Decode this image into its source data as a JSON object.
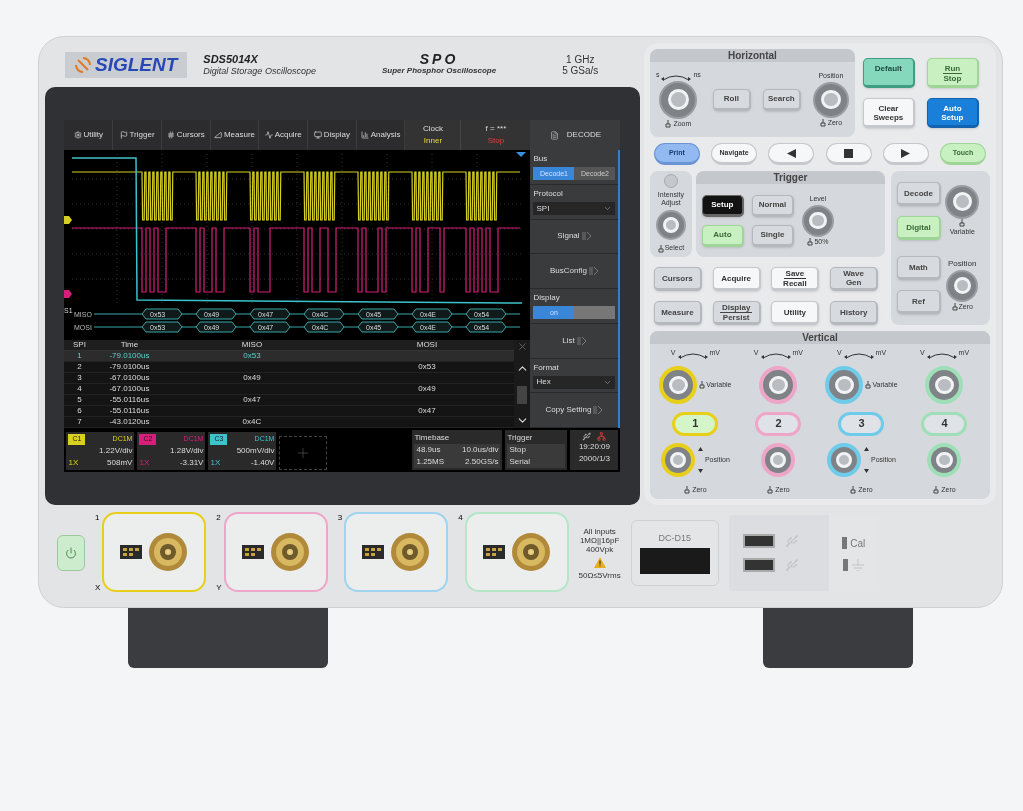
{
  "brand": {
    "logo": "SIGLENT",
    "model": "SDS5014X",
    "description": "Digital Storage Oscilloscope",
    "series": "SPO",
    "series_description": "Super Phosphor Oscilloscope",
    "bandwidth": "1 GHz",
    "sample_rate": "5 GSa/s"
  },
  "screen": {
    "menu": [
      {
        "label": "Utility"
      },
      {
        "label": "Trigger"
      },
      {
        "label": "Cursors"
      },
      {
        "label": "Measure"
      },
      {
        "label": "Acquire"
      },
      {
        "label": "Display"
      },
      {
        "label": "Analysis"
      }
    ],
    "clock": {
      "label": "Clock",
      "value": "Inner"
    },
    "counter": {
      "label": "f = ***",
      "value": "Stop"
    },
    "bus": {
      "label": "S1",
      "lines": [
        {
          "name": "MISO",
          "values": [
            "0x53",
            "0x49",
            "0x47",
            "0x4C",
            "0x45",
            "0x4E",
            "0x54"
          ]
        },
        {
          "name": "MOSI",
          "values": [
            "0x53",
            "0x49",
            "0x47",
            "0x4C",
            "0x45",
            "0x4E",
            "0x54"
          ]
        }
      ]
    },
    "decode_table": {
      "columns": [
        "SPI",
        "Time",
        "MISO",
        "MOSI"
      ],
      "rows": [
        {
          "index": "1",
          "time": "-79.0100us",
          "miso": "0x53",
          "selected": true
        },
        {
          "index": "2",
          "time": "-79.0100us",
          "mosi": "0x53",
          "selected": false
        },
        {
          "index": "3",
          "time": "-67.0100us",
          "miso": "0x49",
          "selected": false
        },
        {
          "index": "4",
          "time": "-67.0100us",
          "mosi": "0x49",
          "selected": false
        },
        {
          "index": "5",
          "time": "-55.0116us",
          "miso": "0x47",
          "selected": false
        },
        {
          "index": "6",
          "time": "-55.0116us",
          "mosi": "0x47",
          "selected": false
        },
        {
          "index": "7",
          "time": "-43.0120us",
          "miso": "0x4C",
          "selected": false
        }
      ]
    },
    "channels": [
      {
        "name": "C1",
        "coupling": "DC1M",
        "scale": "1.22V/div",
        "probe": "1X",
        "offset": "508mV",
        "color": "#d9d11e"
      },
      {
        "name": "C2",
        "coupling": "DC1M",
        "scale": "1.28V/div",
        "probe": "1X",
        "offset": "-3.31V",
        "color": "#d81e7a"
      },
      {
        "name": "C3",
        "coupling": "DC1M",
        "scale": "500mV/div",
        "probe": "1X",
        "offset": "-1.40V",
        "color": "#3cc3cc"
      }
    ],
    "timebase": {
      "label": "Timebase",
      "delay": "48.9us",
      "scale": "10.0us/div",
      "memory": "1.25MS",
      "rate": "2.50GS/s"
    },
    "trigger": {
      "label": "Trigger",
      "state": "Stop",
      "type": "Serial"
    },
    "time": "19:20:09",
    "date": "2000/1/3",
    "side_menu": {
      "title": "DECODE",
      "items": [
        {
          "kind": "tabs",
          "label": "Bus",
          "options": [
            {
              "label": "Decode1",
              "selected": true
            },
            {
              "label": "Decode2",
              "selected": false
            }
          ]
        },
        {
          "kind": "select",
          "label": "Protocol",
          "value": "SPI"
        },
        {
          "kind": "link",
          "label": "Signal"
        },
        {
          "kind": "link",
          "label": "BusConfig"
        },
        {
          "kind": "toggle",
          "label": "Display",
          "value": "on",
          "on": true
        },
        {
          "kind": "link",
          "label": "List"
        },
        {
          "kind": "select",
          "label": "Format",
          "value": "Hex"
        },
        {
          "kind": "link",
          "label": "Copy Setting"
        }
      ]
    }
  },
  "horizontal": {
    "title": "Horizontal",
    "scale_left": "s",
    "scale_right": "ns",
    "scale_push": "Zoom",
    "buttons": [
      "Roll",
      "Search"
    ],
    "position_label": "Position",
    "position_push": "Zero"
  },
  "run_buttons": [
    {
      "lines": [
        "Default"
      ],
      "kind": "teal",
      "divided": false
    },
    {
      "lines": [
        "Run",
        "Stop"
      ],
      "kind": "green",
      "divided": true
    },
    {
      "lines": [
        "Clear",
        "Sweeps"
      ],
      "kind": "white",
      "divided": false
    },
    {
      "lines": [
        "Auto",
        "Setup"
      ],
      "kind": "blue",
      "divided": false
    }
  ],
  "nav_buttons": [
    {
      "kind": "lightblue",
      "label": "Print"
    },
    {
      "kind": "white",
      "label": "Navigate"
    },
    {
      "kind": "prev"
    },
    {
      "kind": "stop"
    },
    {
      "kind": "next"
    },
    {
      "kind": "green",
      "label": "Touch"
    }
  ],
  "intensity": {
    "lines": [
      "Intensity",
      "Adjust"
    ],
    "push": "Select"
  },
  "trigger": {
    "title": "Trigger",
    "buttons": [
      {
        "label": "Setup",
        "kind": "dark"
      },
      {
        "label": "Normal",
        "kind": "plain"
      },
      {
        "label": "Auto",
        "kind": "green"
      },
      {
        "label": "Single",
        "kind": "plain"
      }
    ],
    "level_label": "Level",
    "level_push": "50%"
  },
  "function_buttons": [
    {
      "lines": [
        "Cursors"
      ],
      "kind": "plain",
      "divided": false
    },
    {
      "lines": [
        "Acquire"
      ],
      "kind": "white",
      "divided": false
    },
    {
      "lines": [
        "Save",
        "Recall"
      ],
      "kind": "white",
      "divided": true
    },
    {
      "lines": [
        "Wave",
        "Gen"
      ],
      "kind": "plain",
      "divided": false
    },
    {
      "lines": [
        "Measure"
      ],
      "kind": "plain",
      "divided": false
    },
    {
      "lines": [
        "Display",
        "Persist"
      ],
      "kind": "plain",
      "divided": true
    },
    {
      "lines": [
        "Utility"
      ],
      "kind": "white",
      "divided": false
    },
    {
      "lines": [
        "History"
      ],
      "kind": "plain",
      "divided": false
    }
  ],
  "digital": {
    "buttons": [
      {
        "label": "Decode",
        "kind": "plain"
      },
      {
        "label": "Digital",
        "kind": "green"
      },
      {
        "label": "Math",
        "kind": "plain"
      },
      {
        "label": "Ref",
        "kind": "plain"
      }
    ],
    "variable_push": "Variable",
    "position_label": "Position",
    "position_push": "Zero"
  },
  "vertical": {
    "title": "Vertical",
    "channels": [
      {
        "number": "1",
        "color": "#e8cf1a",
        "on": true,
        "scale_left": "V",
        "scale_right": "mV",
        "variable": "Variable",
        "position": "Position",
        "zero": "Zero"
      },
      {
        "number": "2",
        "color": "#eea6c8",
        "on": false,
        "scale_left": "V",
        "scale_right": "mV",
        "zero": "Zero"
      },
      {
        "number": "3",
        "color": "#6fcbea",
        "on": false,
        "scale_left": "V",
        "scale_right": "mV",
        "variable": "Variable",
        "position": "Position",
        "zero": "Zero"
      },
      {
        "number": "4",
        "color": "#9edfb8",
        "on": false,
        "scale_left": "V",
        "scale_right": "mV",
        "zero": "Zero"
      }
    ]
  },
  "front": {
    "inputs": [
      {
        "number": "1",
        "color": "#e8cf1a",
        "axis": "X"
      },
      {
        "number": "2",
        "color": "#eea6c8",
        "axis": "Y"
      },
      {
        "number": "3",
        "color": "#9fd3ef"
      },
      {
        "number": "4",
        "color": "#b5e6c8"
      }
    ],
    "input_spec": [
      "All inputs",
      "1MΩ||16pF",
      "400Vpk"
    ],
    "input_limit": "50Ω≤5Vrms",
    "port": "DC-D15",
    "cal": "Cal"
  }
}
